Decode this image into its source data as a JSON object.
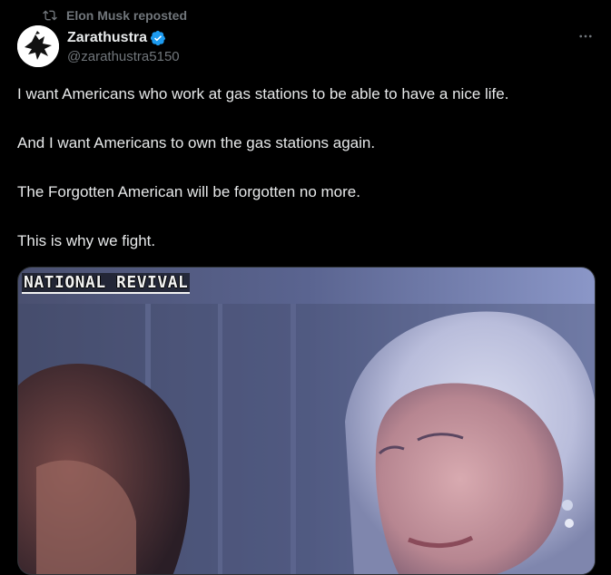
{
  "repost": {
    "label": "Elon Musk reposted",
    "icon": "repost-icon"
  },
  "author": {
    "display_name": "Zarathustra",
    "handle": "@zarathustra5150",
    "verified": true,
    "verified_color": "#1d9bf0",
    "avatar": "raven-avatar"
  },
  "post": {
    "paragraphs": [
      "I want Americans who work at gas stations to be able to have a nice life.",
      "And I want Americans to own the gas stations again.",
      "The Forgotten American will be forgotten no more.",
      "This is why we fight."
    ]
  },
  "media": {
    "caption": "NATIONAL REVIVAL"
  },
  "colors": {
    "background": "#000000",
    "text": "#e7e9ea",
    "muted": "#71767b"
  }
}
